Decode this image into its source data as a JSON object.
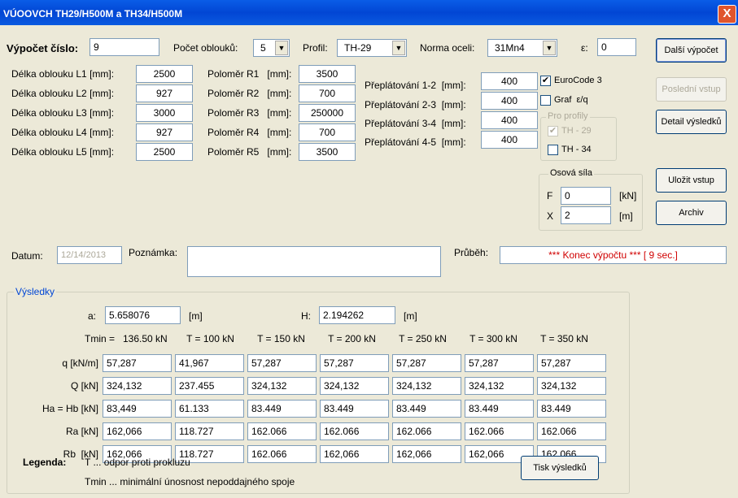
{
  "window": {
    "title": "VÚOOVCH TH29/H500M a TH34/H500M",
    "close_symbol": "X"
  },
  "header": {
    "vypocet_label": "Výpočet číslo:",
    "vypocet_value": "9",
    "pocet_label": "Počet oblouků:",
    "pocet_value": "5",
    "profil_label": "Profil:",
    "profil_value": "TH-29",
    "norma_label": "Norma oceli:",
    "norma_value": "31Mn4",
    "eps_label": "ε:",
    "eps_value": "0"
  },
  "lengths": [
    {
      "label": "Délka oblouku L1 [mm]:",
      "value": "2500"
    },
    {
      "label": "Délka oblouku L2 [mm]:",
      "value": "927"
    },
    {
      "label": "Délka oblouku L3 [mm]:",
      "value": "3000"
    },
    {
      "label": "Délka oblouku L4 [mm]:",
      "value": "927"
    },
    {
      "label": "Délka oblouku L5 [mm]:",
      "value": "2500"
    }
  ],
  "radii": [
    {
      "label": "Poloměr R1   [mm]:",
      "value": "3500"
    },
    {
      "label": "Poloměr R2   [mm]:",
      "value": "700"
    },
    {
      "label": "Poloměr R3   [mm]:",
      "value": "250000"
    },
    {
      "label": "Poloměr R4   [mm]:",
      "value": "700"
    },
    {
      "label": "Poloměr R5   [mm]:",
      "value": "3500"
    }
  ],
  "overlaps": [
    {
      "label": "Přeplátování 1-2  [mm]:",
      "value": "400"
    },
    {
      "label": "Přeplátování 2-3  [mm]:",
      "value": "400"
    },
    {
      "label": "Přeplátování 3-4  [mm]:",
      "value": "400"
    },
    {
      "label": "Přeplátování 4-5  [mm]:",
      "value": "400"
    }
  ],
  "options": {
    "eurocode_label": "EuroCode 3",
    "eurocode_checked": "✔",
    "graf_label": "Graf  ε/q",
    "pro_profily_legend": "Pro profily",
    "th29_label": "TH - 29",
    "th29_checked": "✔",
    "th34_label": "TH - 34"
  },
  "axial": {
    "legend": "Osová síla",
    "f_label": "F",
    "f_value": "0",
    "f_unit": "[kN]",
    "x_label": "X",
    "x_value": "2",
    "x_unit": "[m]"
  },
  "buttons": {
    "next": "Další výpočet",
    "last": "Poslední vstup",
    "detail": "Detail výsledků",
    "save": "Uložit vstup",
    "archive": "Archiv",
    "print": "Tisk výsledků"
  },
  "misc": {
    "datum_label": "Datum:",
    "datum_value": "12/14/2013",
    "poznamka_label": "Poznámka:",
    "poznamka_value": "",
    "prubeh_label": "Průběh:",
    "prubeh_value": "*** Konec výpočtu *** [ 9 sec.]"
  },
  "results": {
    "legend": "Výsledky",
    "a_label": "a:",
    "a_value": "5.658076",
    "a_unit": "[m]",
    "h_label": "H:",
    "h_value": "2.194262",
    "h_unit": "[m]",
    "columns": [
      "Tmin =   136.50 kN",
      "T = 100 kN",
      "T = 150 kN",
      "T = 200 kN",
      "T = 250 kN",
      "T = 300 kN",
      "T = 350 kN"
    ],
    "rows": [
      {
        "label": "q [kN/m]",
        "values": [
          "57,287",
          "41,967",
          "57,287",
          "57,287",
          "57,287",
          "57,287",
          "57,287"
        ]
      },
      {
        "label": "Q [kN]",
        "values": [
          "324,132",
          "237.455",
          "324,132",
          "324,132",
          "324,132",
          "324,132",
          "324,132"
        ]
      },
      {
        "label": "Ha = Hb [kN]",
        "values": [
          "83,449",
          "61.133",
          "83.449",
          "83.449",
          "83.449",
          "83.449",
          "83.449"
        ]
      },
      {
        "label": "Ra [kN]",
        "values": [
          "162,066",
          "118.727",
          "162.066",
          "162.066",
          "162.066",
          "162.066",
          "162.066"
        ]
      },
      {
        "label": "Rb  [kN]",
        "values": [
          "162,066",
          "118.727",
          "162.066",
          "162,066",
          "162,066",
          "162,066",
          "162,066"
        ]
      }
    ],
    "legenda_label": "Legenda:",
    "legend_line1": "T ... odpor proti prokluzu",
    "legend_line2": "Tmin ... minimální únosnost nepoddajného spoje"
  }
}
